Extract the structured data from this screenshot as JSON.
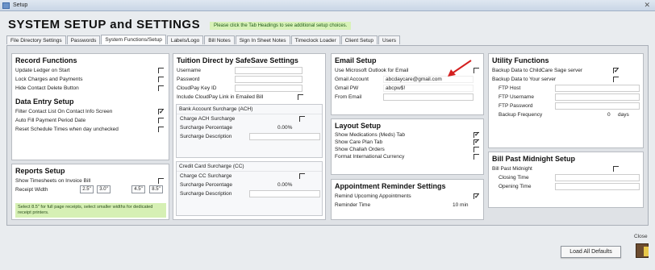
{
  "window": {
    "title": "Setup",
    "close": "✕"
  },
  "headline": "SYSTEM SETUP and SETTINGS",
  "notice": "Please click the Tab Headings to see additional setup choices.",
  "tabs": [
    "File Directory Settings",
    "Passwords",
    "System Functions/Setup",
    "Labels/Logo",
    "Bill Notes",
    "Sign In Sheet Notes",
    "Timeclock Loader",
    "Client Setup",
    "Users"
  ],
  "record": {
    "title": "Record Functions",
    "items": [
      {
        "label": "Update Ledger on Start",
        "checked": false
      },
      {
        "label": "Lock Charges and Payments",
        "checked": false
      },
      {
        "label": "Hide Contact Delete Button",
        "checked": false
      }
    ]
  },
  "dataentry": {
    "title": "Data Entry Setup",
    "items": [
      {
        "label": "Filter Contact List On Contact Info Screen",
        "checked": true
      },
      {
        "label": "Auto Fill Payment Period Date",
        "checked": false
      },
      {
        "label": "Reset Schedule Times when day unchecked",
        "checked": false
      }
    ]
  },
  "reports": {
    "title": "Reports Setup",
    "timesheets": "Show Timesheets on Invoice Bill",
    "receipt_width": "Receipt Width",
    "widths": [
      "2.5\"",
      "3.0\"",
      "4.5\"",
      "8.5\""
    ],
    "note": "Select 8.5\" for full page receipts, select smaller widths for dedicated receipt printers."
  },
  "tuition": {
    "title": "Tuition Direct by SafeSave Settings",
    "username": "Username",
    "password": "Password",
    "keyid": "CloudPay Key ID",
    "include_link": "Include CloudPay Link in Emailed Bill",
    "ach": {
      "title": "Bank Account Surcharge (ACH)",
      "charge": "Charge ACH Surcharge",
      "percent_label": "Surcharge Percentage",
      "percent_value": "0.00%",
      "desc": "Surcharge Description"
    },
    "cc": {
      "title": "Credit Card Surcharge (CC)",
      "charge": "Charge CC Surcharge",
      "percent_label": "Surcharge Percentage",
      "percent_value": "0.00%",
      "desc": "Surcharge Description"
    }
  },
  "email": {
    "title": "Email Setup",
    "outlook": "Use Microsoft Outlook for Email",
    "account_label": "Gmail Account",
    "account_value": "abcdaycare@gmail.com",
    "pw_label": "Gmail PW",
    "pw_value": "abcpw$!",
    "from_label": "From Email"
  },
  "layout": {
    "title": "Layout Setup",
    "items": [
      {
        "label": "Show Medications (Meds) Tab",
        "checked": true
      },
      {
        "label": "Show Care Plan Tab",
        "checked": true
      },
      {
        "label": "Show Challah Orders",
        "checked": false
      },
      {
        "label": "Format International Currency",
        "checked": false
      }
    ]
  },
  "appointments": {
    "title": "Appointment Reminder Settings",
    "remind": "Remind Upcoming Appointments",
    "time_label": "Reminder Time",
    "time_value": "10 min"
  },
  "utility": {
    "title": "Utility Functions",
    "backup_sage": "Backup Data to ChildCare Sage server",
    "backup_yours": "Backup Data to Your server",
    "ftp_host": "FTP Host",
    "ftp_user": "FTP Username",
    "ftp_pass": "FTP Password",
    "freq_label": "Backup Frequency",
    "freq_value": "0",
    "freq_unit": "days"
  },
  "billpast": {
    "title": "Bill Past Midnight Setup",
    "label": "Bill Past Midnight",
    "closing": "Closing Time",
    "opening": "Opening Time"
  },
  "footer": {
    "load_defaults": "Load All Defaults",
    "close": "Close"
  }
}
